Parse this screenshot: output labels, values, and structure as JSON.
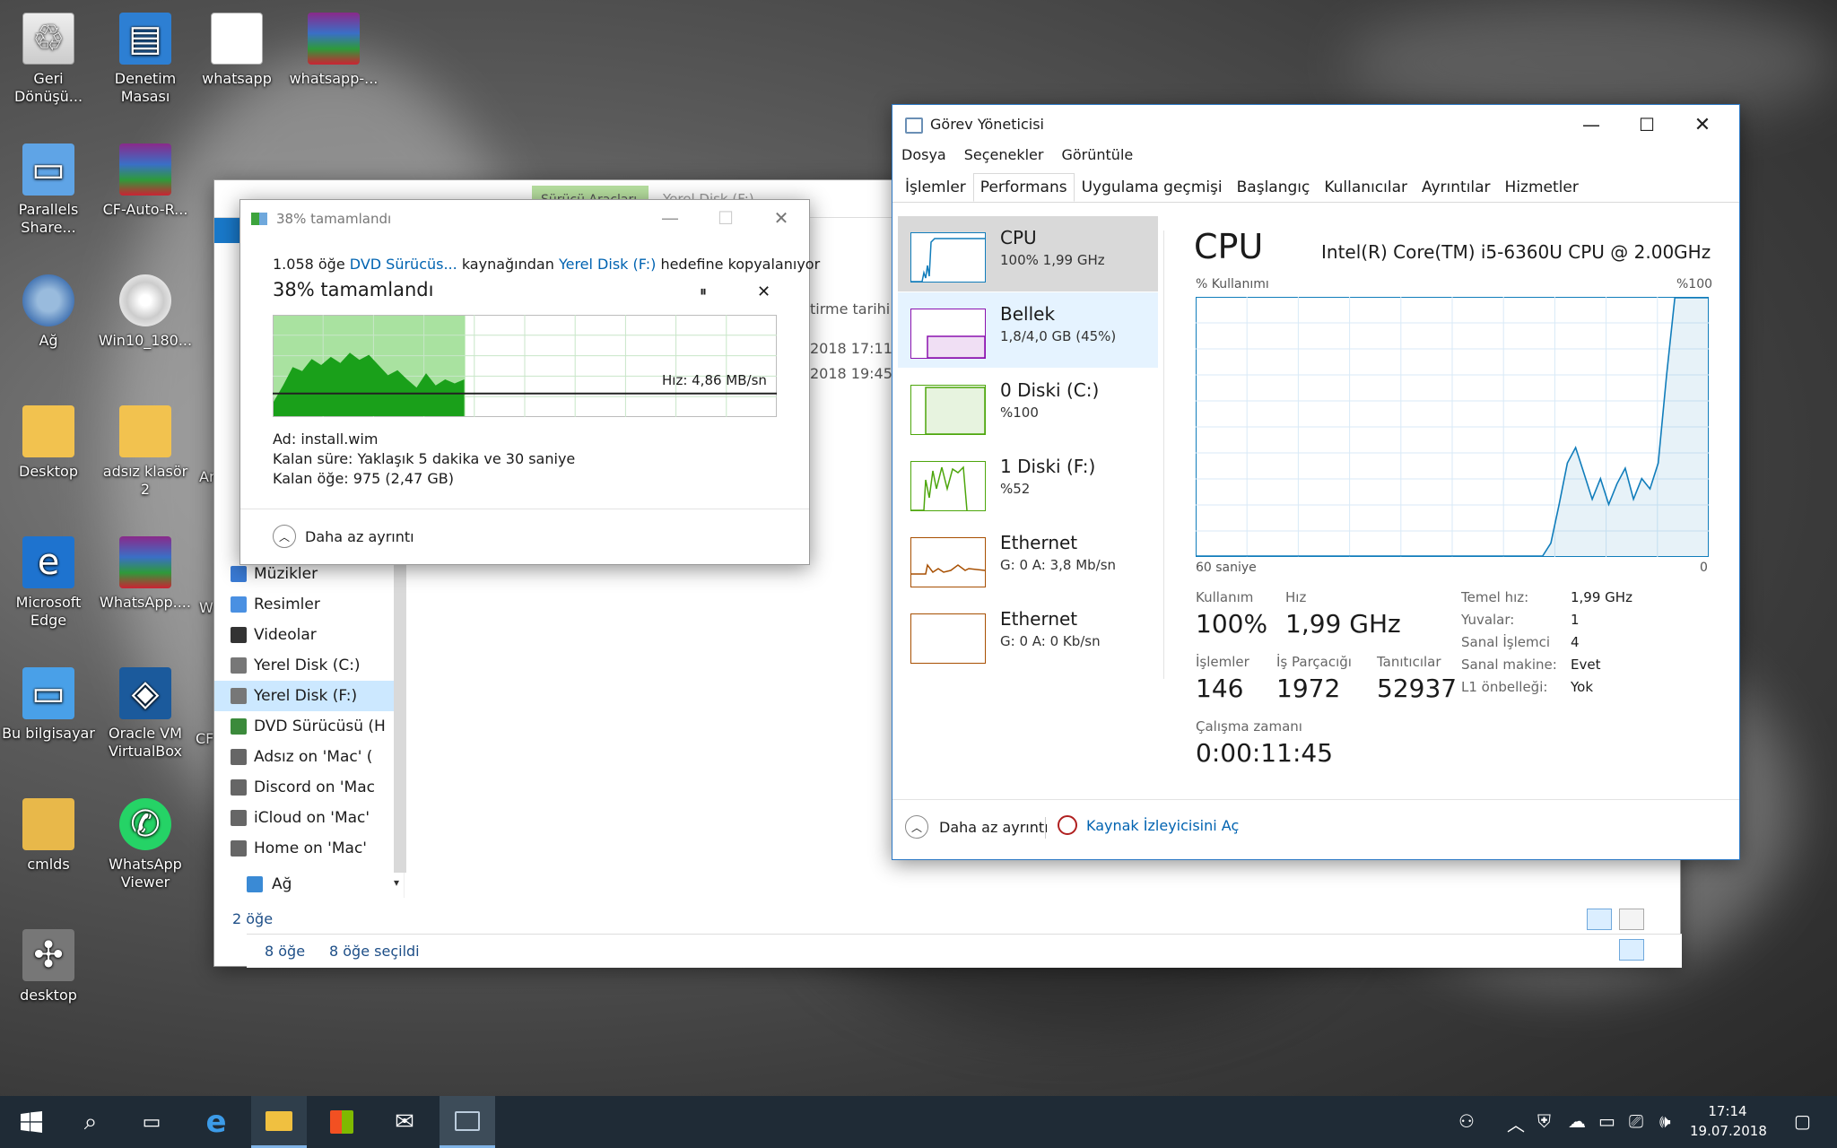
{
  "desktop": {
    "icons": [
      {
        "label": "Geri Dönüşü...",
        "icon": "recycle-bin-icon"
      },
      {
        "label": "Denetim Masası",
        "icon": "control-panel-icon"
      },
      {
        "label": "whatsapp",
        "icon": "document-icon"
      },
      {
        "label": "whatsapp-...",
        "icon": "winrar-icon"
      },
      {
        "label": "Parallels Share...",
        "icon": "parallels-share-icon"
      },
      {
        "label": "CF-Auto-R...",
        "icon": "winrar-icon"
      },
      {
        "label": "Ağ",
        "icon": "network-icon"
      },
      {
        "label": "Win10_180...",
        "icon": "disc-image-icon"
      },
      {
        "label": "Desktop",
        "icon": "folder-icon"
      },
      {
        "label": "adsız klasör 2",
        "icon": "folder-icon"
      },
      {
        "label": "Microsoft Edge",
        "icon": "edge-icon"
      },
      {
        "label": "WhatsApp....",
        "icon": "winrar-icon"
      },
      {
        "label": "Bu bilgisayar",
        "icon": "this-pc-icon"
      },
      {
        "label": "Oracle VM VirtualBox",
        "icon": "virtualbox-icon"
      },
      {
        "label": "cmlds",
        "icon": "user-folder-icon"
      },
      {
        "label": "WhatsApp Viewer",
        "icon": "whatsapp-icon"
      },
      {
        "label": "desktop",
        "icon": "puzzle-icon"
      }
    ],
    "clipped_labels": [
      "Ar",
      "W",
      "CF"
    ]
  },
  "explorer": {
    "tab_active": "Sürücü Araçları",
    "tab_title": "Yerel Disk (F:)",
    "column_header": "tirme tarihi",
    "dates": [
      "2018 17:11",
      "2018 19:45"
    ],
    "nav": [
      {
        "label": "Müzikler",
        "icon": "music-icon"
      },
      {
        "label": "Resimler",
        "icon": "pictures-icon"
      },
      {
        "label": "Videolar",
        "icon": "videos-icon"
      },
      {
        "label": "Yerel Disk (C:)",
        "icon": "drive-icon"
      },
      {
        "label": "Yerel Disk (F:)",
        "icon": "drive-icon",
        "selected": true
      },
      {
        "label": "DVD Sürücüsü (H",
        "icon": "dvd-icon"
      },
      {
        "label": "Adsız on 'Mac' (",
        "icon": "network-drive-icon"
      },
      {
        "label": "Discord on 'Mac",
        "icon": "network-drive-icon"
      },
      {
        "label": "iCloud on 'Mac'",
        "icon": "network-drive-icon"
      },
      {
        "label": "Home on 'Mac'",
        "icon": "network-drive-icon"
      },
      {
        "label": "Ağ",
        "icon": "network-icon"
      }
    ],
    "status_inner": "2 öğe",
    "status_outer_count": "8 öğe",
    "status_outer_selected": "8 öğe seçildi"
  },
  "copy_dialog": {
    "title": "38% tamamlandı",
    "line_prefix": "1.058 öğe",
    "source": "DVD Sürücüs...",
    "mid": "kaynağından",
    "dest": "Yerel Disk (F:)",
    "suffix": "hedefine kopyalanıyor",
    "progress_heading": "38%  tamamlandı",
    "progress": 0.38,
    "speed": "Hız: 4,86 MB/sn",
    "name_label": "Ad:",
    "name_value": "install.wim",
    "time_label": "Kalan süre:",
    "time_value": "Yaklaşık 5 dakika ve 30 saniye",
    "items_label": "Kalan öğe:",
    "items_value": "975 (2,47 GB)",
    "less_details": "Daha az ayrıntı",
    "pause": "⏸",
    "cancel": "✕",
    "throughput": [
      0.14,
      0.3,
      0.48,
      0.44,
      0.56,
      0.5,
      0.58,
      0.52,
      0.62,
      0.55,
      0.6,
      0.5,
      0.4,
      0.45,
      0.36,
      0.28,
      0.42,
      0.3,
      0.36,
      0.32,
      0.36
    ]
  },
  "task_manager": {
    "title": "Görev Yöneticisi",
    "menu": [
      "Dosya",
      "Seçenekler",
      "Görüntüle"
    ],
    "tabs": [
      "İşlemler",
      "Performans",
      "Uygulama geçmişi",
      "Başlangıç",
      "Kullanıcılar",
      "Ayrıntılar",
      "Hizmetler"
    ],
    "active_tab": 1,
    "sidebar": [
      {
        "title": "CPU",
        "sub": "100% 1,99 GHz",
        "color": "#117dbb"
      },
      {
        "title": "Bellek",
        "sub": "1,8/4,0 GB (45%)",
        "color": "#8b12ae"
      },
      {
        "title": "0 Diski (C:)",
        "sub": "%100",
        "color": "#4da60c"
      },
      {
        "title": "1 Diski (F:)",
        "sub": "%52",
        "color": "#4da60c"
      },
      {
        "title": "Ethernet",
        "sub": "G: 0 A: 3,8 Mb/sn",
        "color": "#a74f01"
      },
      {
        "title": "Ethernet",
        "sub": "G: 0 A: 0 Kb/sn",
        "color": "#a74f01"
      }
    ],
    "cpu_title": "CPU",
    "cpu_model": "Intel(R) Core(TM) i5-6360U CPU @ 2.00GHz",
    "usage_label": "% Kullanımı",
    "usage_max": "%100",
    "time_span": "60 saniye",
    "time_zero": "0",
    "stats": {
      "usage_label": "Kullanım",
      "usage": "100%",
      "speed_label": "Hız",
      "speed": "1,99 GHz",
      "proc_label": "İşlemler",
      "proc": "146",
      "threads_label": "İş Parçacığı",
      "threads": "1972",
      "handles_label": "Tanıtıcılar",
      "handles": "52937",
      "uptime_label": "Çalışma zamanı",
      "uptime": "0:00:11:45"
    },
    "specs": [
      {
        "k": "Temel hız:",
        "v": "1,99 GHz"
      },
      {
        "k": "Yuvalar:",
        "v": "1"
      },
      {
        "k": "Sanal İşlemci",
        "v": "4"
      },
      {
        "k": "Sanal makine:",
        "v": "Evet"
      },
      {
        "k": "L1 önbelleği:",
        "v": "Yok"
      }
    ],
    "less_details": "Daha az ayrıntı",
    "open_resmon": "Kaynak İzleyicisini Aç",
    "cpu_history": [
      0,
      0,
      0,
      0,
      0,
      0,
      0,
      0,
      0,
      0,
      0,
      0,
      0,
      0,
      0,
      0,
      0,
      0,
      0,
      0,
      0,
      0,
      0,
      0,
      0,
      0,
      0,
      0,
      0,
      0,
      0,
      0,
      0,
      0,
      0,
      0,
      0,
      0,
      0,
      0,
      0,
      0,
      0,
      5,
      20,
      36,
      42,
      32,
      22,
      30,
      20,
      28,
      34,
      22,
      30,
      26,
      36,
      70,
      100,
      100,
      100,
      100,
      100
    ]
  },
  "taskbar": {
    "clock_time": "17:14",
    "clock_date": "19.07.2018",
    "apps": [
      "start-icon",
      "search-icon",
      "task-view-icon",
      "edge-icon",
      "file-explorer-icon",
      "store-icon",
      "mail-icon",
      "task-manager-icon"
    ]
  }
}
